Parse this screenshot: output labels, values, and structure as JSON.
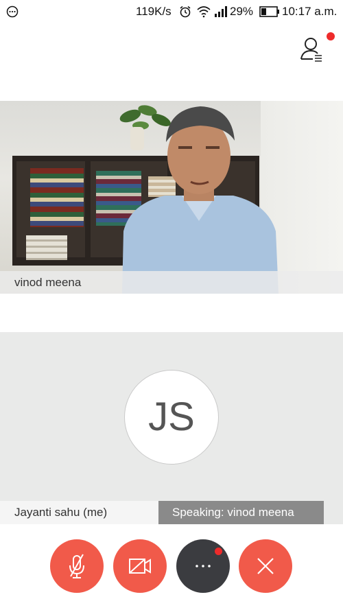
{
  "status_bar": {
    "speed": "119K/s",
    "battery": "29%",
    "time": "10:17 a.m.",
    "icons": [
      "more-circle-icon",
      "alarm-icon",
      "wifi-icon",
      "signal-icon",
      "battery-icon"
    ]
  },
  "header": {
    "participants_icon": "participants-icon",
    "notification_dot_color": "#ee2b2b"
  },
  "remote_video": {
    "participant_name": "vinod meena"
  },
  "self_tile": {
    "initials": "JS",
    "name": "Jayanti sahu (me)",
    "speaking": "Speaking: vinod meena"
  },
  "controls": [
    {
      "name": "mute-microphone-button",
      "icon": "mic-off-icon",
      "color": "#f15a4a"
    },
    {
      "name": "toggle-video-button",
      "icon": "video-off-icon",
      "color": "#f15a4a"
    },
    {
      "name": "more-options-button",
      "icon": "more-horizontal-icon",
      "color": "#3b3c40"
    },
    {
      "name": "end-call-button",
      "icon": "close-icon",
      "color": "#f15a4a"
    }
  ]
}
